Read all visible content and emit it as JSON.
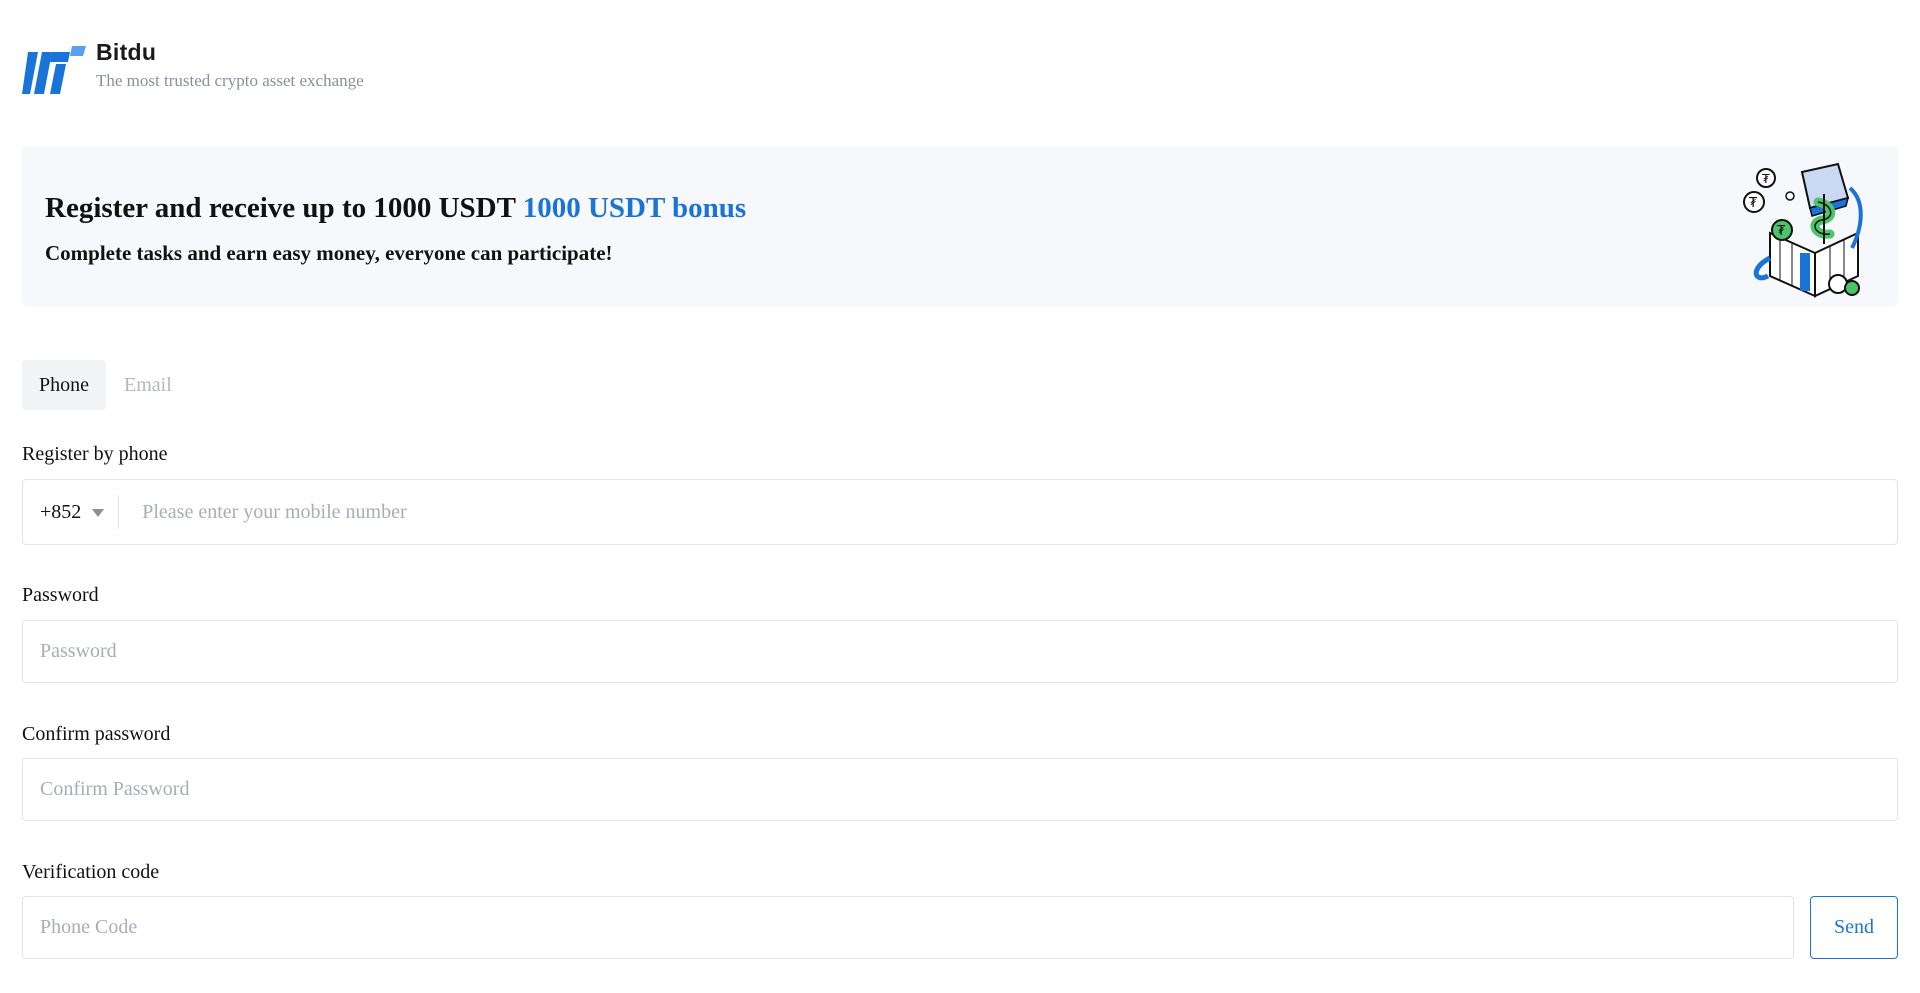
{
  "header": {
    "brand_name": "Bitdu",
    "tagline": "The most trusted crypto asset exchange"
  },
  "banner": {
    "title_main": "Register and receive up to 1000 USDT",
    "title_accent": "1000 USDT bonus",
    "subtitle": "Complete tasks and earn easy money, everyone can participate!"
  },
  "tabs": [
    {
      "label": "Phone",
      "active": true
    },
    {
      "label": "Email",
      "active": false
    }
  ],
  "form": {
    "phone": {
      "label": "Register by phone",
      "country_code": "+852",
      "placeholder": "Please enter your mobile number"
    },
    "password": {
      "label": "Password",
      "placeholder": "Password"
    },
    "confirm_password": {
      "label": "Confirm password",
      "placeholder": "Confirm Password"
    },
    "verification": {
      "label": "Verification code",
      "placeholder": "Phone Code",
      "send_label": "Send"
    }
  },
  "colors": {
    "accent": "#1a74d8",
    "banner_bg": "#f6f8fb",
    "muted": "#a9adb5"
  },
  "icons": {
    "logo": "bitdu-logo",
    "banner_art": "gift-box-dollar-illustration",
    "dropdown": "caret-down-icon"
  }
}
